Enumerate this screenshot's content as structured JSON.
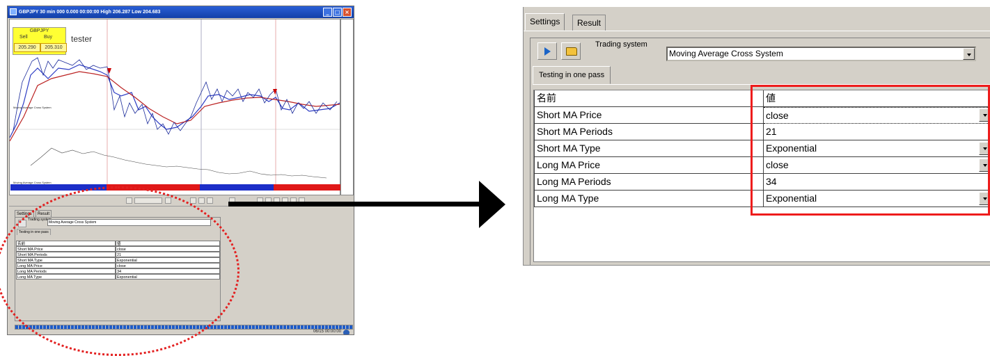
{
  "small_window": {
    "title": "GBPJPY 30 min 000 0.000 00:00:00 High 206.287 Low 204.683",
    "quote": {
      "pair": "GBPJPY",
      "sell_label": "Sell",
      "buy_label": "Buy",
      "sell_value": "205.290",
      "buy_value": "205.310"
    },
    "tester_label": "tester",
    "time": "06/15 00:00:00",
    "tabs": [
      "Settings",
      "Result"
    ],
    "system_label": "Trading system",
    "system_value": "Moving Average Cross System",
    "subtab": "Testing in one pass",
    "header": {
      "name": "名前",
      "value": "値"
    },
    "rows": [
      {
        "name": "Short MA Price",
        "value": "close"
      },
      {
        "name": "Short MA Periods",
        "value": "21"
      },
      {
        "name": "Short MA Type",
        "value": "Exponential"
      },
      {
        "name": "Long MA Price",
        "value": "close"
      },
      {
        "name": "Long MA Periods",
        "value": "34"
      },
      {
        "name": "Long MA Type",
        "value": "Exponential"
      }
    ]
  },
  "panel": {
    "tab_settings": "Settings",
    "tab_result": "Result",
    "system_label": "Trading system",
    "system_value": "Moving Average Cross System",
    "subtab": "Testing in one pass",
    "header": {
      "name": "名前",
      "value": "値"
    },
    "rows": [
      {
        "name": "Short MA Price",
        "value": "close",
        "dropdown": true
      },
      {
        "name": "Short MA Periods",
        "value": "21",
        "dropdown": false
      },
      {
        "name": "Short MA Type",
        "value": "Exponential",
        "dropdown": true
      },
      {
        "name": "Long MA Price",
        "value": "close",
        "dropdown": true
      },
      {
        "name": "Long MA Periods",
        "value": "34",
        "dropdown": false
      },
      {
        "name": "Long MA Type",
        "value": "Exponential",
        "dropdown": true
      }
    ]
  },
  "colors": {
    "highlight": "#ee1c1c",
    "arrow": "#000000",
    "buy_signal": "#1c2ec8",
    "sell_signal": "#e01818"
  }
}
